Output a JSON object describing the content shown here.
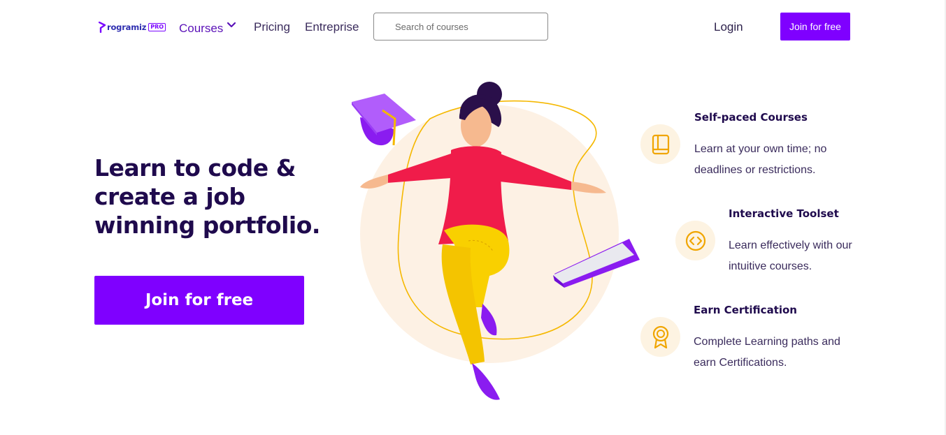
{
  "header": {
    "logo_text": "rogramiz",
    "logo_badge": "PRO",
    "nav": {
      "courses": "Courses",
      "pricing": "Pricing",
      "enterprise": "Entreprise"
    },
    "search_placeholder": "Search of courses",
    "login": "Login",
    "join_button": "Join for free"
  },
  "hero": {
    "title": "Learn to code & create a job winning portfolio.",
    "cta": "Join for free"
  },
  "features": [
    {
      "icon": "book-icon",
      "title": "Self-paced Courses",
      "description": "Learn at your own time; no deadlines or restrictions."
    },
    {
      "icon": "code-icon",
      "title": "Interactive Toolset",
      "description": "Learn effectively with our intuitive courses."
    },
    {
      "icon": "award-icon",
      "title": "Earn Certification",
      "description": "Complete Learning paths and earn Certifications."
    }
  ],
  "colors": {
    "brand": "#7f00ff",
    "heading": "#1f0a4d",
    "icon_accent": "#f0a500",
    "icon_bg": "#fdf3e2"
  }
}
